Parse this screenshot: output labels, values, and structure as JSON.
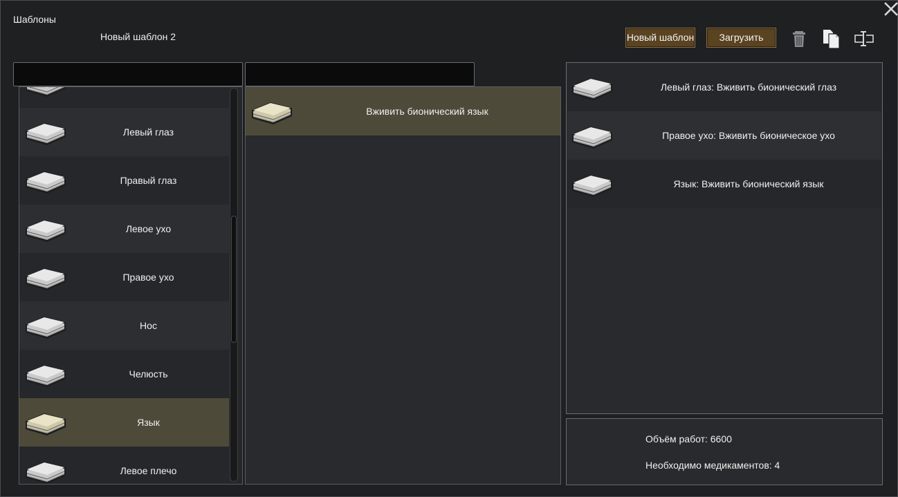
{
  "window": {
    "title": "Шаблоны",
    "template_name": "Новый шаблон 2"
  },
  "toolbar": {
    "new_template": "Новый шаблон",
    "load": "Загрузить",
    "icons": [
      "trash-icon",
      "copy-icon",
      "rename-icon"
    ]
  },
  "search": {
    "left_value": "",
    "mid_value": ""
  },
  "body_parts": [
    {
      "label": "",
      "state": "normal"
    },
    {
      "label": "Левый глаз",
      "state": "normal"
    },
    {
      "label": "Правый глаз",
      "state": "normal"
    },
    {
      "label": "Левое ухо",
      "state": "normal"
    },
    {
      "label": "Правое ухо",
      "state": "normal"
    },
    {
      "label": "Нос",
      "state": "normal"
    },
    {
      "label": "Челюсть",
      "state": "normal"
    },
    {
      "label": "Язык",
      "state": "selected"
    },
    {
      "label": "Левое плечо",
      "state": "normal"
    }
  ],
  "operations": [
    {
      "label": "Вживить бионический язык",
      "state": "selected"
    }
  ],
  "template_items": [
    {
      "label": "Левый глаз: Вживить бионический глаз"
    },
    {
      "label": "Правое ухо: Вживить бионическое ухо"
    },
    {
      "label": "Язык: Вживить бионический язык"
    }
  ],
  "info": {
    "work_amount": "Объём работ: 6600",
    "medicine_needed": "Необходимо медикаментов: 4"
  },
  "colors": {
    "selected_row": "#4d4a3a",
    "button_brown": "#5a4321",
    "background": "#1f2022"
  }
}
